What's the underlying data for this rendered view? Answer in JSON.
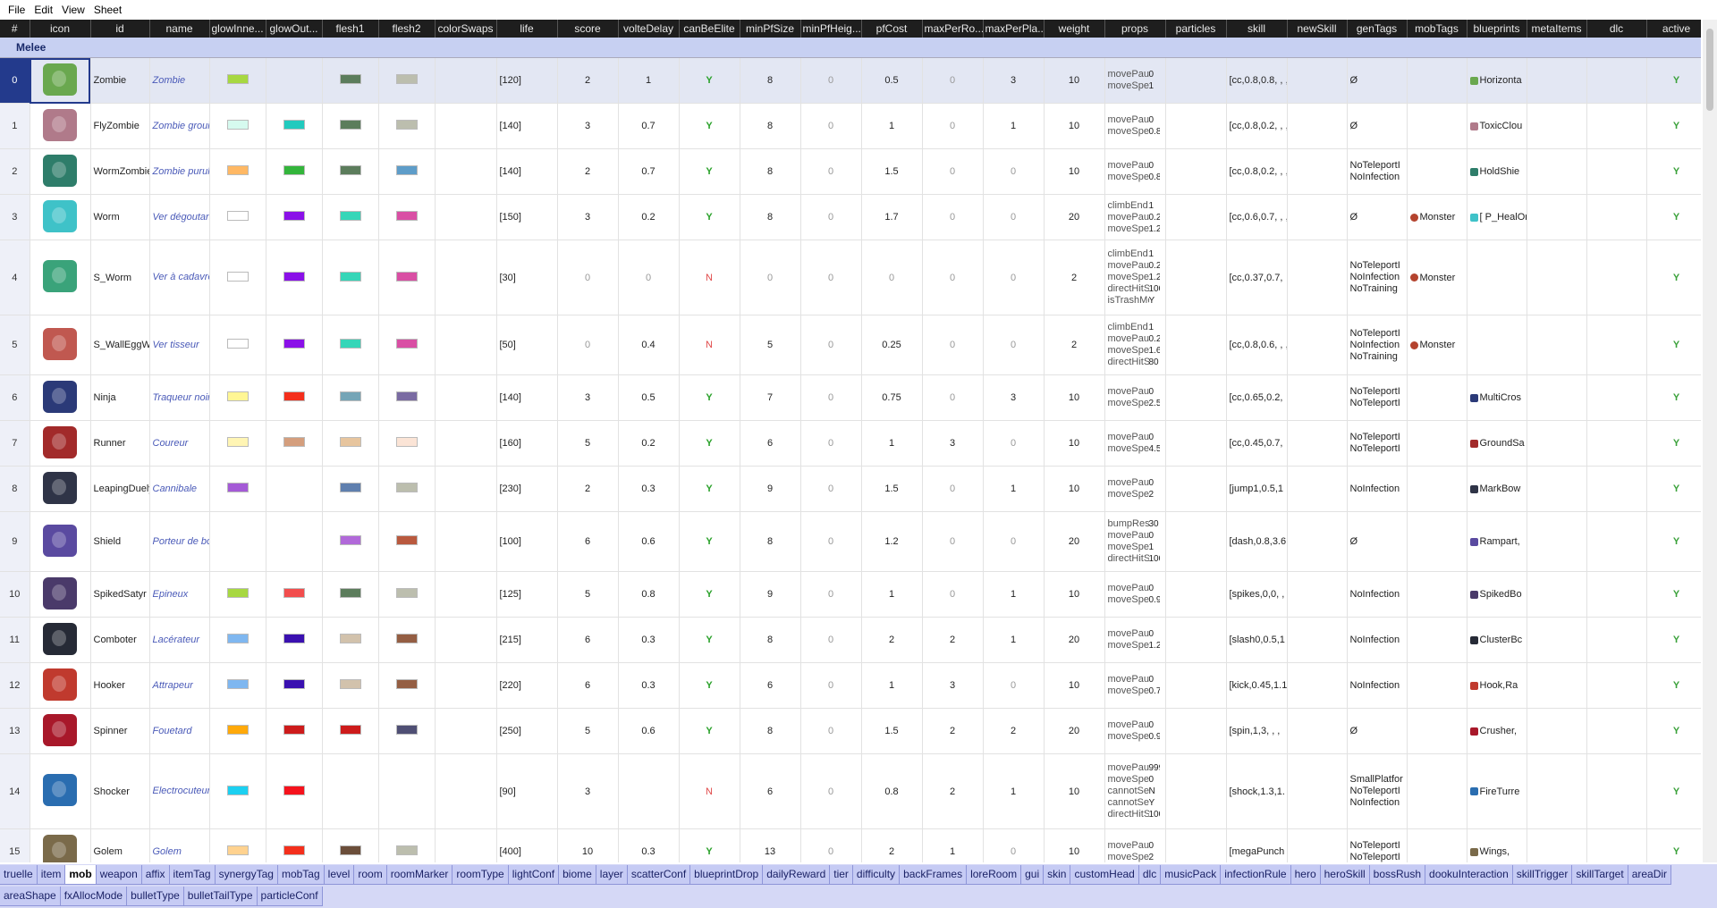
{
  "menu": [
    "File",
    "Edit",
    "View",
    "Sheet"
  ],
  "columns": [
    {
      "label": "#",
      "w": 33
    },
    {
      "label": "icon",
      "w": 68
    },
    {
      "label": "id",
      "w": 66
    },
    {
      "label": "name",
      "w": 67
    },
    {
      "label": "glowInne...",
      "w": 63
    },
    {
      "label": "glowOut...",
      "w": 63
    },
    {
      "label": "flesh1",
      "w": 63
    },
    {
      "label": "flesh2",
      "w": 63
    },
    {
      "label": "colorSwaps",
      "w": 69
    },
    {
      "label": "life",
      "w": 68
    },
    {
      "label": "score",
      "w": 68
    },
    {
      "label": "volteDelay",
      "w": 68
    },
    {
      "label": "canBeElite",
      "w": 68
    },
    {
      "label": "minPfSize",
      "w": 68
    },
    {
      "label": "minPfHeig...",
      "w": 68
    },
    {
      "label": "pfCost",
      "w": 68
    },
    {
      "label": "maxPerRo...",
      "w": 68
    },
    {
      "label": "maxPerPla...",
      "w": 68
    },
    {
      "label": "weight",
      "w": 68
    },
    {
      "label": "props",
      "w": 68
    },
    {
      "label": "particles",
      "w": 68
    },
    {
      "label": "skill",
      "w": 68
    },
    {
      "label": "newSkill",
      "w": 67
    },
    {
      "label": "genTags",
      "w": 67
    },
    {
      "label": "mobTags",
      "w": 67
    },
    {
      "label": "blueprints",
      "w": 67
    },
    {
      "label": "metaItems",
      "w": 67
    },
    {
      "label": "dlc",
      "w": 67
    },
    {
      "label": "active",
      "w": 67
    }
  ],
  "group_label": "Melee",
  "rows": [
    {
      "n": "0",
      "id": "Zombie",
      "name": "Zombie",
      "glowIn": "#a7d841",
      "glowOut": "",
      "flesh1": "#5c7d5c",
      "flesh2": "#bcbeae",
      "life": "[120]",
      "score": "2",
      "volte": "1",
      "elite": "Y",
      "minPf": "8",
      "minPfH": "0",
      "pfCost": "0.5",
      "maxRo": "0",
      "maxPla": "3",
      "weight": "10",
      "props": [
        [
          "movePaus...",
          "0"
        ],
        [
          "moveSpe...",
          "1"
        ]
      ],
      "skill": "[cc,0.8,0.8, , ,",
      "genTags": [
        "Ø"
      ],
      "mobTags": "",
      "blueprint": "Horizonta",
      "metaItems": "",
      "active": "Y",
      "sprite": "#6aa84f",
      "h": 51,
      "sel": true
    },
    {
      "n": "1",
      "id": "FlyZombie",
      "name": "Zombie grouillant",
      "glowIn": "#d6faef",
      "glowOut": "#21cabe",
      "flesh1": "#5c7d5c",
      "flesh2": "#bcbeae",
      "life": "[140]",
      "score": "3",
      "volte": "0.7",
      "elite": "Y",
      "minPf": "8",
      "minPfH": "0",
      "pfCost": "1",
      "maxRo": "0",
      "maxPla": "1",
      "weight": "10",
      "props": [
        [
          "movePaus...",
          "0"
        ],
        [
          "moveSpe...",
          "0.8"
        ]
      ],
      "skill": "[cc,0.8,0.2, , ,",
      "genTags": [
        "Ø"
      ],
      "mobTags": "",
      "blueprint": "ToxicClou",
      "metaItems": "",
      "active": "Y",
      "sprite": "#b07a8a",
      "h": 51
    },
    {
      "n": "2",
      "id": "WormZombie",
      "name": "Zombie purulent",
      "glowIn": "#ffb864",
      "glowOut": "#33b53b",
      "flesh1": "#5c7d5c",
      "flesh2": "#5e9dc9",
      "life": "[140]",
      "score": "2",
      "volte": "0.7",
      "elite": "Y",
      "minPf": "8",
      "minPfH": "0",
      "pfCost": "1.5",
      "maxRo": "0",
      "maxPla": "0",
      "weight": "10",
      "props": [
        [
          "movePaus...",
          "0"
        ],
        [
          "moveSpe...",
          "0.8"
        ]
      ],
      "skill": "[cc,0.8,0.2, , ,",
      "genTags": [
        "NoTeleportI",
        "NoInfection"
      ],
      "mobTags": "",
      "blueprint": "HoldShie",
      "metaItems": "",
      "active": "Y",
      "sprite": "#2e7d6a",
      "h": 51
    },
    {
      "n": "3",
      "id": "Worm",
      "name": "Ver dégoutant",
      "glowIn": "#ffffff",
      "glowOut": "#8a10e8",
      "flesh1": "#36d6b8",
      "flesh2": "#d94fa4",
      "life": "[150]",
      "score": "3",
      "volte": "0.2",
      "elite": "Y",
      "minPf": "8",
      "minPfH": "0",
      "pfCost": "1.7",
      "maxRo": "0",
      "maxPla": "0",
      "weight": "20",
      "props": [
        [
          "climbEnd...",
          "1"
        ],
        [
          "movePaus...",
          "0.2"
        ],
        [
          "moveSpe...",
          "1.2"
        ]
      ],
      "skill": "[cc,0.6,0.7, , ,",
      "genTags": [
        "Ø"
      ],
      "mobTags": "Monster",
      "blueprint": "[ P_HealOr",
      "metaItems": "",
      "active": "Y",
      "sprite": "#3fc2c8",
      "h": 51
    },
    {
      "n": "4",
      "id": "S_Worm",
      "name": "Ver à cadavre",
      "glowIn": "#ffffff",
      "glowOut": "#8a10e8",
      "flesh1": "#36d6b8",
      "flesh2": "#d94fa4",
      "life": "[30]",
      "score": "0",
      "volte": "0",
      "elite": "N",
      "minPf": "0",
      "minPfH": "0",
      "pfCost": "0",
      "maxRo": "0",
      "maxPla": "0",
      "weight": "2",
      "props": [
        [
          "climbEnd...",
          "1"
        ],
        [
          "movePaus...",
          "0.2"
        ],
        [
          "moveSpe...",
          "1.2"
        ],
        [
          "directHitS...",
          "100"
        ],
        [
          "isTrashMob",
          "Y"
        ]
      ],
      "skill": "[cc,0.37,0.7,",
      "genTags": [
        "NoTeleportI",
        "NoInfection",
        "NoTraining"
      ],
      "mobTags": "Monster",
      "blueprint": "",
      "metaItems": "",
      "active": "Y",
      "sprite": "#3aa37a",
      "h": 84
    },
    {
      "n": "5",
      "id": "S_WallEggWorm",
      "name": "Ver tisseur",
      "glowIn": "#ffffff",
      "glowOut": "#8a10e8",
      "flesh1": "#36d6b8",
      "flesh2": "#d94fa4",
      "life": "[50]",
      "score": "0",
      "volte": "0.4",
      "elite": "N",
      "minPf": "5",
      "minPfH": "0",
      "pfCost": "0.25",
      "maxRo": "0",
      "maxPla": "0",
      "weight": "2",
      "props": [
        [
          "climbEnd...",
          "1"
        ],
        [
          "movePaus...",
          "0.2"
        ],
        [
          "moveSpe...",
          "1.6"
        ],
        [
          "directHitS...",
          "80"
        ]
      ],
      "skill": "[cc,0.8,0.6, , ,",
      "genTags": [
        "NoTeleportI",
        "NoInfection",
        "NoTraining"
      ],
      "mobTags": "Monster",
      "blueprint": "",
      "metaItems": "",
      "active": "Y",
      "sprite": "#c05850",
      "h": 67
    },
    {
      "n": "6",
      "id": "Ninja",
      "name": "Traqueur noir",
      "glowIn": "#fff694",
      "glowOut": "#f42f1c",
      "flesh1": "#75a5b7",
      "flesh2": "#7a6ba2",
      "life": "[140]",
      "score": "3",
      "volte": "0.5",
      "elite": "Y",
      "minPf": "7",
      "minPfH": "0",
      "pfCost": "0.75",
      "maxRo": "0",
      "maxPla": "3",
      "weight": "10",
      "props": [
        [
          "movePaus...",
          "0"
        ],
        [
          "moveSpe...",
          "2.5"
        ]
      ],
      "skill": "[cc,0.65,0.2,",
      "genTags": [
        "NoTeleportI",
        "NoTeleportI"
      ],
      "mobTags": "",
      "blueprint": "MultiCros",
      "metaItems": "",
      "active": "Y",
      "sprite": "#2b3a78",
      "h": 51
    },
    {
      "n": "7",
      "id": "Runner",
      "name": "Coureur",
      "glowIn": "#fff5b4",
      "glowOut": "#d49e7d",
      "flesh1": "#e7c59e",
      "flesh2": "#fbe4d6",
      "life": "[160]",
      "score": "5",
      "volte": "0.2",
      "elite": "Y",
      "minPf": "6",
      "minPfH": "0",
      "pfCost": "1",
      "maxRo": "3",
      "maxPla": "0",
      "weight": "10",
      "props": [
        [
          "movePaus...",
          "0"
        ],
        [
          "moveSpe...",
          "4.5"
        ]
      ],
      "skill": "[cc,0.45,0.7,",
      "genTags": [
        "NoTeleportI",
        "NoTeleportI"
      ],
      "mobTags": "",
      "blueprint": "GroundSa",
      "metaItems": "",
      "active": "Y",
      "sprite": "#a22a2a",
      "h": 51
    },
    {
      "n": "8",
      "id": "LeapingDuelyst",
      "name": "Cannibale",
      "glowIn": "#a45ad6",
      "glowOut": "",
      "flesh1": "#5f7fae",
      "flesh2": "#bcbeae",
      "life": "[230]",
      "score": "2",
      "volte": "0.3",
      "elite": "Y",
      "minPf": "9",
      "minPfH": "0",
      "pfCost": "1.5",
      "maxRo": "0",
      "maxPla": "1",
      "weight": "10",
      "props": [
        [
          "movePaus...",
          "0"
        ],
        [
          "moveSpe...",
          "2"
        ]
      ],
      "skill": "[jump1,0.5,1",
      "genTags": [
        "NoInfection"
      ],
      "mobTags": "",
      "blueprint": "MarkBow",
      "metaItems": "",
      "active": "Y",
      "sprite": "#2f3447",
      "h": 51
    },
    {
      "n": "9",
      "id": "Shield",
      "name": "Porteur de bouclier",
      "glowIn": "",
      "glowOut": "",
      "flesh1": "#b169d9",
      "flesh2": "#b9593e",
      "life": "[100]",
      "score": "6",
      "volte": "0.6",
      "elite": "Y",
      "minPf": "8",
      "minPfH": "0",
      "pfCost": "1.2",
      "maxRo": "0",
      "maxPla": "0",
      "weight": "20",
      "props": [
        [
          "bumpResi...",
          "30"
        ],
        [
          "movePaus...",
          "0"
        ],
        [
          "moveSpe...",
          "1"
        ],
        [
          "directHitS...",
          "100"
        ]
      ],
      "skill": "[dash,0.8,3.6",
      "genTags": [
        "Ø"
      ],
      "mobTags": "",
      "blueprint": "Rampart,",
      "metaItems": "",
      "active": "Y",
      "sprite": "#5a4aa0",
      "h": 67
    },
    {
      "n": "10",
      "id": "SpikedSatyr",
      "name": "Epineux",
      "glowIn": "#a7d841",
      "glowOut": "#f24d4d",
      "flesh1": "#5c7d5c",
      "flesh2": "#bcbeae",
      "life": "[125]",
      "score": "5",
      "volte": "0.8",
      "elite": "Y",
      "minPf": "9",
      "minPfH": "0",
      "pfCost": "1",
      "maxRo": "0",
      "maxPla": "1",
      "weight": "10",
      "props": [
        [
          "movePaus...",
          "0"
        ],
        [
          "moveSpe...",
          "0.9"
        ]
      ],
      "skill": "[spikes,0,0, ,",
      "genTags": [
        "NoInfection"
      ],
      "mobTags": "",
      "blueprint": "SpikedBo",
      "metaItems": "",
      "active": "Y",
      "sprite": "#4a3a6a",
      "h": 51
    },
    {
      "n": "11",
      "id": "Comboter",
      "name": "Lacérateur",
      "glowIn": "#7fb7f0",
      "glowOut": "#3a10b0",
      "flesh1": "#d2c2ac",
      "flesh2": "#945e43",
      "life": "[215]",
      "score": "6",
      "volte": "0.3",
      "elite": "Y",
      "minPf": "8",
      "minPfH": "0",
      "pfCost": "2",
      "maxRo": "2",
      "maxPla": "1",
      "weight": "20",
      "props": [
        [
          "movePaus...",
          "0"
        ],
        [
          "moveSpe...",
          "1.2"
        ]
      ],
      "skill": "[slash0,0.5,1",
      "genTags": [
        "NoInfection"
      ],
      "mobTags": "",
      "blueprint": "ClusterBc",
      "metaItems": "",
      "active": "Y",
      "sprite": "#262a36",
      "h": 51
    },
    {
      "n": "12",
      "id": "Hooker",
      "name": "Attrapeur",
      "glowIn": "#7fb7f0",
      "glowOut": "#3a10b0",
      "flesh1": "#d2c2ac",
      "flesh2": "#945e43",
      "life": "[220]",
      "score": "6",
      "volte": "0.3",
      "elite": "Y",
      "minPf": "6",
      "minPfH": "0",
      "pfCost": "1",
      "maxRo": "3",
      "maxPla": "0",
      "weight": "10",
      "props": [
        [
          "movePaus...",
          "0"
        ],
        [
          "moveSpe...",
          "0.7"
        ]
      ],
      "skill": "[kick,0.45,1.1",
      "genTags": [
        "NoInfection"
      ],
      "mobTags": "",
      "blueprint": "Hook,Ra",
      "metaItems": "",
      "active": "Y",
      "sprite": "#c03a2e",
      "h": 51
    },
    {
      "n": "13",
      "id": "Spinner",
      "name": "Fouetard",
      "glowIn": "#ffa90a",
      "glowOut": "#cd1b1b",
      "flesh1": "#cd1b1b",
      "flesh2": "#4f4f74",
      "life": "[250]",
      "score": "5",
      "volte": "0.6",
      "elite": "Y",
      "minPf": "8",
      "minPfH": "0",
      "pfCost": "1.5",
      "maxRo": "2",
      "maxPla": "2",
      "weight": "20",
      "props": [
        [
          "movePaus...",
          "0"
        ],
        [
          "moveSpe...",
          "0.9"
        ]
      ],
      "skill": "[spin,1,3, , ,",
      "genTags": [
        "Ø"
      ],
      "mobTags": "",
      "blueprint": "Crusher,",
      "metaItems": "",
      "active": "Y",
      "sprite": "#a8182a",
      "h": 51
    },
    {
      "n": "14",
      "id": "Shocker",
      "name": "Electrocuteur",
      "glowIn": "#1cd0f1",
      "glowOut": "#f5121c",
      "flesh1": "",
      "flesh2": "",
      "life": "[90]",
      "score": "3",
      "volte": "",
      "elite": "N",
      "minPf": "6",
      "minPfH": "0",
      "pfCost": "0.8",
      "maxRo": "2",
      "maxPla": "1",
      "weight": "10",
      "props": [
        [
          "movePaus...",
          "999"
        ],
        [
          "moveSpe...",
          "0"
        ],
        [
          "cannotSe...",
          "N"
        ],
        [
          "cannotSe...",
          "Y"
        ],
        [
          "directHitS...",
          "100"
        ]
      ],
      "skill": "[shock,1.3,1.",
      "genTags": [
        "SmallPlatfor",
        "NoTeleportI",
        "NoInfection"
      ],
      "mobTags": "",
      "blueprint": "FireTurre",
      "metaItems": "",
      "active": "Y",
      "sprite": "#2a6db0",
      "h": 84
    },
    {
      "n": "15",
      "id": "Golem",
      "name": "Golem",
      "glowIn": "#ffd28f",
      "glowOut": "#f42f1c",
      "flesh1": "#6b4e3a",
      "flesh2": "#bcbeae",
      "life": "[400]",
      "score": "10",
      "volte": "0.3",
      "elite": "Y",
      "minPf": "13",
      "minPfH": "0",
      "pfCost": "2",
      "maxRo": "1",
      "maxPla": "0",
      "weight": "10",
      "props": [
        [
          "movePaus...",
          "0"
        ],
        [
          "moveSpe...",
          "2"
        ]
      ],
      "skill": "[megaPunch",
      "genTags": [
        "NoTeleportI",
        "NoTeleportI"
      ],
      "mobTags": "",
      "blueprint": "Wings,",
      "metaItems": "",
      "active": "Y",
      "sprite": "#7a6a4a",
      "h": 51
    }
  ],
  "tabs": [
    "truelle",
    "item",
    "mob",
    "weapon",
    "affix",
    "itemTag",
    "synergyTag",
    "mobTag",
    "level",
    "room",
    "roomMarker",
    "roomType",
    "lightConf",
    "biome",
    "layer",
    "scatterConf",
    "blueprintDrop",
    "dailyReward",
    "tier",
    "difficulty",
    "backFrames",
    "loreRoom",
    "gui",
    "skin",
    "customHead",
    "dlc",
    "musicPack",
    "infectionRule",
    "hero",
    "heroSkill",
    "bossRush",
    "dookuInteraction",
    "skillTrigger",
    "skillTarget",
    "areaDir",
    "areaShape",
    "fxAllocMode",
    "bulletType",
    "bulletTailType",
    "particleConf"
  ],
  "active_tab": "mob"
}
